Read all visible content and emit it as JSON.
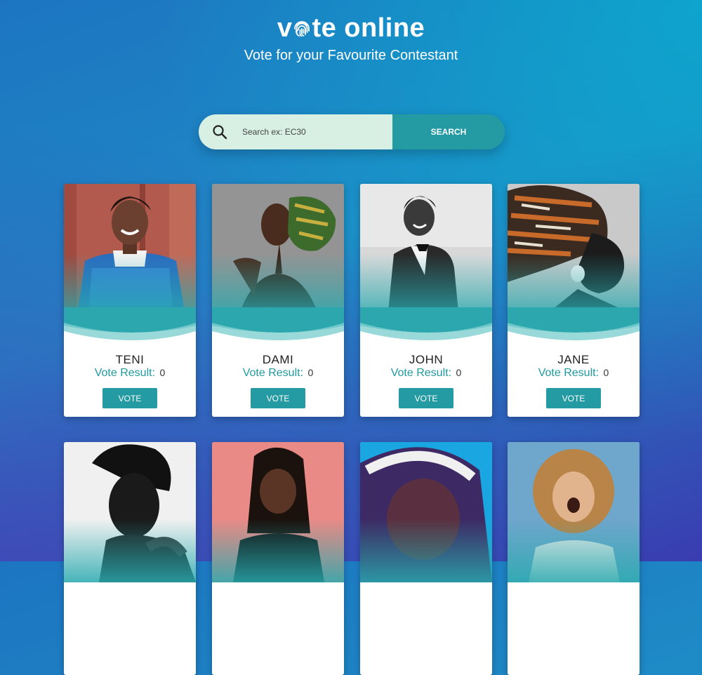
{
  "header": {
    "logo_prefix": "v",
    "logo_rest": "te online",
    "tagline": "Vote for your Favourite Contestant"
  },
  "search": {
    "placeholder": "Search ex: EC30",
    "button_label": "SEARCH",
    "icon": "search-icon"
  },
  "contestants": [
    {
      "name": "TENI",
      "result_label": "Vote Result:",
      "result_value": "0",
      "vote_label": "VOTE"
    },
    {
      "name": "DAMI",
      "result_label": "Vote Result:",
      "result_value": "0",
      "vote_label": "VOTE"
    },
    {
      "name": "JOHN",
      "result_label": "Vote Result:",
      "result_value": "0",
      "vote_label": "VOTE"
    },
    {
      "name": "JANE",
      "result_label": "Vote Result:",
      "result_value": "0",
      "vote_label": "VOTE"
    }
  ],
  "colors": {
    "accent": "#249aa2",
    "search_bg": "#d8efe4",
    "gradient_top": "#1d75c1",
    "gradient_bottom": "#3a3cb0"
  }
}
